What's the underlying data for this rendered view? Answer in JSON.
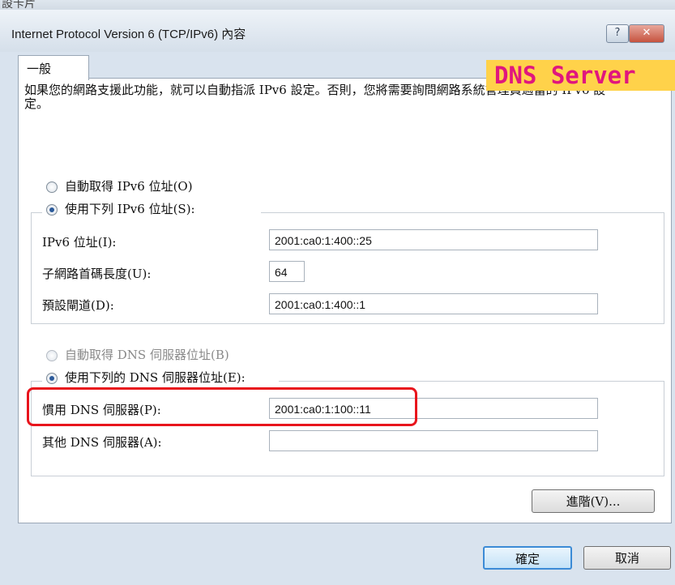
{
  "background": {
    "top_text": "設卡片"
  },
  "dialog": {
    "title": "Internet Protocol Version 6 (TCP/IPv6) 內容",
    "help_label": "?",
    "close_label": "✕"
  },
  "tab": {
    "label": "一般"
  },
  "banner": {
    "text": "DNS Server"
  },
  "description": "如果您的網路支援此功能，就可以自動指派 IPv6 設定。否則，您將需要詢問網路系統管理員適當的 IPv6 設定。",
  "ip": {
    "auto_label": "自動取得 IPv6 位址(O)",
    "manual_label": "使用下列 IPv6 位址(S):",
    "address_label": "IPv6 位址(I):",
    "address_value": "2001:ca0:1:400::25",
    "prefix_label": "子網路首碼長度(U):",
    "prefix_value": "64",
    "gateway_label": "預設閘道(D):",
    "gateway_value": "2001:ca0:1:400::1"
  },
  "dns": {
    "auto_label": "自動取得 DNS 伺服器位址(B)",
    "manual_label": "使用下列的 DNS 伺服器位址(E):",
    "preferred_label": "慣用 DNS 伺服器(P):",
    "preferred_value": "2001:ca0:1:100::11",
    "alternate_label": "其他 DNS 伺服器(A):",
    "alternate_value": ""
  },
  "buttons": {
    "advanced": "進階(V)...",
    "ok": "確定",
    "cancel": "取消"
  },
  "colors": {
    "highlight_border": "#e8141c",
    "banner_bg": "#ffd24a",
    "banner_text": "#e0167e"
  }
}
